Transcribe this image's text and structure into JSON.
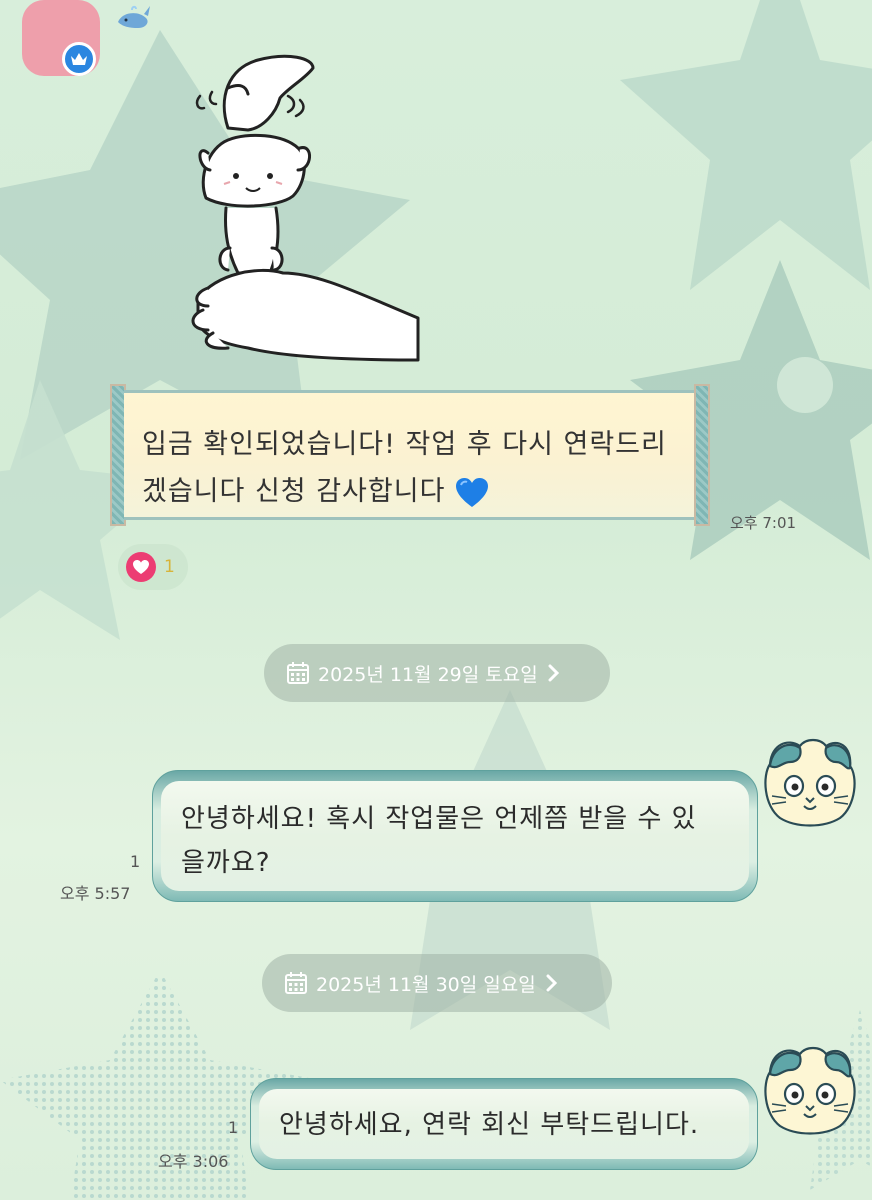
{
  "messages": {
    "incoming": {
      "text_line1": "입금 확인되었습니다! 작업 후 다시 연락드리",
      "text_line2": "겠습니다 신청 감사합니다",
      "time": "오후 7:01",
      "reaction_count": "1"
    },
    "date_separators": [
      "2025년 11월 29일 토요일",
      "2025년 11월 30일 일요일"
    ],
    "outgoing": [
      {
        "line1": "안녕하세요! 혹시 작업물은 언제쯤 받을 수 있",
        "line2": "을까요?",
        "read": "1",
        "time": "오후 5:57"
      },
      {
        "line1": "안녕하세요, 연락 회신 부탁드립니다.",
        "read": "1",
        "time": "오후 3:06"
      }
    ]
  },
  "icons": {
    "crown": "crown-icon",
    "whale": "whale-icon",
    "heart": "blue-heart-emoji",
    "reaction": "heart-reaction-icon",
    "calendar": "calendar-icon",
    "chevron": "chevron-right-icon"
  },
  "colors": {
    "profile_pink": "#ee9fab",
    "crown_blue": "#2b86e0",
    "reaction_pink": "#ec3d73",
    "bubble_teal": "#6aa8a6"
  }
}
